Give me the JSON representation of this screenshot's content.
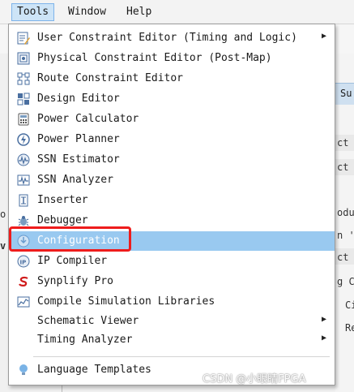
{
  "menubar": {
    "tools": "Tools",
    "window": "Window",
    "help": "Help"
  },
  "tools_menu": {
    "items": [
      {
        "label": "User Constraint Editor (Timing and Logic)",
        "icon": "constraint-editor-icon",
        "submenu": true
      },
      {
        "label": "Physical Constraint Editor (Post-Map)",
        "icon": "physical-constraint-icon"
      },
      {
        "label": "Route Constraint Editor",
        "icon": "route-constraint-icon"
      },
      {
        "label": "Design Editor",
        "icon": "design-editor-icon"
      },
      {
        "label": "Power Calculator",
        "icon": "calculator-icon"
      },
      {
        "label": "Power Planner",
        "icon": "power-planner-icon"
      },
      {
        "label": "SSN Estimator",
        "icon": "ssn-estimator-icon"
      },
      {
        "label": "SSN Analyzer",
        "icon": "ssn-analyzer-icon"
      },
      {
        "label": "Inserter",
        "icon": "inserter-icon"
      },
      {
        "label": "Debugger",
        "icon": "debugger-bug-icon"
      },
      {
        "label": "Configuration",
        "icon": "configuration-icon",
        "highlighted": true
      },
      {
        "label": "IP Compiler",
        "icon": "ip-compiler-icon"
      },
      {
        "label": "Synplify Pro",
        "icon": "synplify-logo-icon"
      },
      {
        "label": "Compile Simulation Libraries",
        "icon": "simulation-libraries-icon"
      },
      {
        "label": "Schematic Viewer",
        "icon": "",
        "submenu": true
      },
      {
        "label": "Timing Analyzer",
        "icon": "",
        "submenu": true
      },
      {
        "label": "Language Templates",
        "icon": "lightbulb-icon"
      }
    ],
    "submenu_arrow": "▶"
  },
  "background": {
    "left_fragments": [
      "o",
      "v"
    ],
    "right_tab": "Su",
    "right_fragments": [
      "ct",
      "ct",
      "odu",
      "n '",
      "ct",
      "g C",
      "Ci",
      "Re"
    ]
  },
  "watermark": "CSDN @小眼睛FPGA",
  "colors": {
    "highlight": "#99c9f0",
    "callout": "#ee1c1c",
    "active_menu": "#cde4f7"
  }
}
